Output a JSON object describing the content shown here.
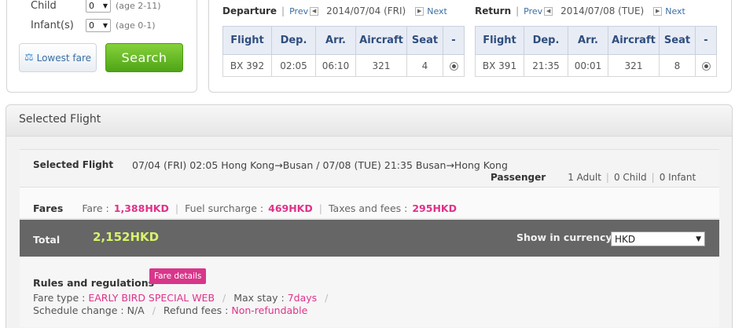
{
  "search": {
    "child_label": "Child",
    "child_value": "0",
    "child_hint": "(age 2-11)",
    "infant_label": "Infant(s)",
    "infant_value": "0",
    "infant_hint": "(age 0-1)",
    "lowest_fare_label": "Lowest fare",
    "search_label": "Search"
  },
  "departure": {
    "title": "Departure",
    "prev": "Prev",
    "date": "2014/07/04 (FRI)",
    "next": "Next",
    "headers": [
      "Flight",
      "Dep.",
      "Arr.",
      "Aircraft",
      "Seat",
      "-"
    ],
    "row": {
      "flight": "BX 392",
      "dep": "02:05",
      "arr": "06:10",
      "aircraft": "321",
      "seat": "4"
    }
  },
  "return": {
    "title": "Return",
    "prev": "Prev",
    "date": "2014/07/08 (TUE)",
    "next": "Next",
    "headers": [
      "Flight",
      "Dep.",
      "Arr.",
      "Aircraft",
      "Seat",
      "-"
    ],
    "row": {
      "flight": "BX 391",
      "dep": "21:35",
      "arr": "00:01",
      "aircraft": "321",
      "seat": "8"
    }
  },
  "selected": {
    "header": "Selected Flight",
    "summary_title": "Selected Flight",
    "itinerary": "07/04 (FRI) 02:05 Hong Kong→Busan  / 07/08 (TUE) 21:35 Busan→Hong Kong",
    "passenger_label": "Passenger",
    "adult": "1 Adult",
    "child": "0 Child",
    "infant": "0 Infant"
  },
  "fares": {
    "title": "Fares",
    "fare_label": "Fare :",
    "fare_value": "1,388HKD",
    "fuel_label": "Fuel surcharge :",
    "fuel_value": "469HKD",
    "taxes_label": "Taxes and fees :",
    "taxes_value": "295HKD"
  },
  "total": {
    "label": "Total",
    "value": "2,152HKD",
    "currency_label": "Show in currency",
    "currency_value": "HKD"
  },
  "rules": {
    "title": "Rules and regulations",
    "fare_details_label": "Fare details",
    "fare_type_label": "Fare type :",
    "fare_type_value": "EARLY BIRD SPECIAL WEB",
    "max_stay_label": "Max stay :",
    "max_stay_value": "7days",
    "schedule_change_label": "Schedule change :",
    "schedule_change_value": "N/A",
    "refund_label": "Refund fees :",
    "refund_value": "Non-refundable"
  }
}
